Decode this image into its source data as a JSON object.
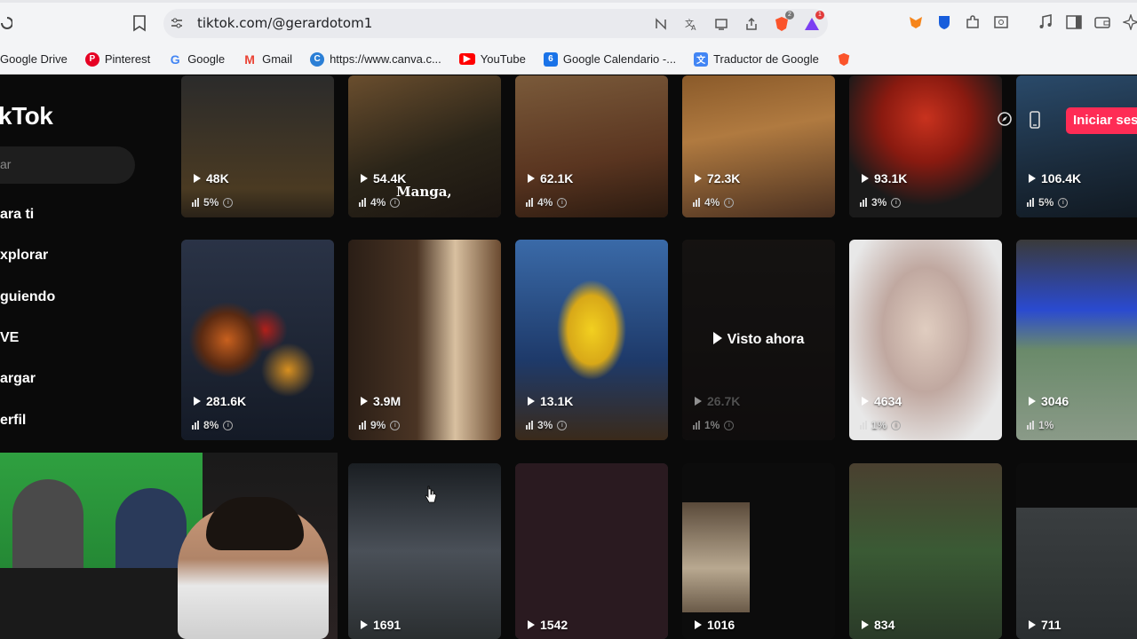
{
  "browser": {
    "url": "tiktok.com/@gerardotom1",
    "brave_count": "2",
    "alert_count": "1",
    "bookmarks": [
      {
        "label": "Google Drive",
        "icon": "google-drive-icon",
        "color": "#1fa463"
      },
      {
        "label": "Pinterest",
        "icon": "pinterest-icon",
        "color": "#e60023"
      },
      {
        "label": "Google",
        "icon": "google-icon",
        "color": "#4285f4"
      },
      {
        "label": "Gmail",
        "icon": "gmail-icon",
        "color": "#ea4335"
      },
      {
        "label": "https://www.canva.c...",
        "icon": "canva-icon",
        "color": "#7d2ae8"
      },
      {
        "label": "YouTube",
        "icon": "youtube-icon",
        "color": "#ff0000"
      },
      {
        "label": "Google Calendario -...",
        "icon": "google-calendar-icon",
        "color": "#1a73e8"
      },
      {
        "label": "Traductor de Google",
        "icon": "google-translate-icon",
        "color": "#4285f4"
      },
      {
        "label": "",
        "icon": "brave-icon",
        "color": "#fb542b"
      }
    ]
  },
  "tiktok": {
    "logo": "kTok",
    "search_placeholder": "ar",
    "nav": [
      {
        "label": "ara ti"
      },
      {
        "label": "xplorar"
      },
      {
        "label": "guiendo"
      },
      {
        "label": "VE"
      },
      {
        "label": "argar"
      },
      {
        "label": "erfil"
      }
    ],
    "login_label": "Iniciar ses",
    "videos_row1": [
      {
        "views": "48K",
        "pct": "5%",
        "bg": "#3a3326"
      },
      {
        "views": "54.4K",
        "pct": "4%",
        "bg": "#3d3124",
        "caption": "Manga,"
      },
      {
        "views": "62.1K",
        "pct": "4%",
        "bg": "#5a3a24"
      },
      {
        "views": "72.3K",
        "pct": "4%",
        "bg": "#6a4626"
      },
      {
        "views": "93.1K",
        "pct": "3%",
        "bg": "#4a2020"
      },
      {
        "views": "106.4K",
        "pct": "5%",
        "bg": "#1f2f3a"
      }
    ],
    "videos_row2": [
      {
        "views": "281.6K",
        "pct": "8%",
        "bg": "#1c2330"
      },
      {
        "views": "3.9M",
        "pct": "9%",
        "bg": "#3b2a1e"
      },
      {
        "views": "13.1K",
        "pct": "3%",
        "bg": "#2a4a7a"
      },
      {
        "views": "26.7K",
        "pct": "1%",
        "bg": "#1a1414",
        "watched": "Visto ahora"
      },
      {
        "views": "4634",
        "pct": "1%",
        "bg": "#c9b8b0"
      },
      {
        "views": "3046",
        "pct": "1%",
        "bg": "#5b6b8a"
      }
    ],
    "videos_row3": [
      {
        "views": "1691",
        "bg": "#2d3238"
      },
      {
        "views": "1542",
        "bg": "#2a1a20"
      },
      {
        "views": "1016",
        "bg": "#0c0c0c"
      },
      {
        "views": "834",
        "bg": "#3a4a38"
      },
      {
        "views": "711",
        "bg": "#2a2e30"
      }
    ]
  }
}
